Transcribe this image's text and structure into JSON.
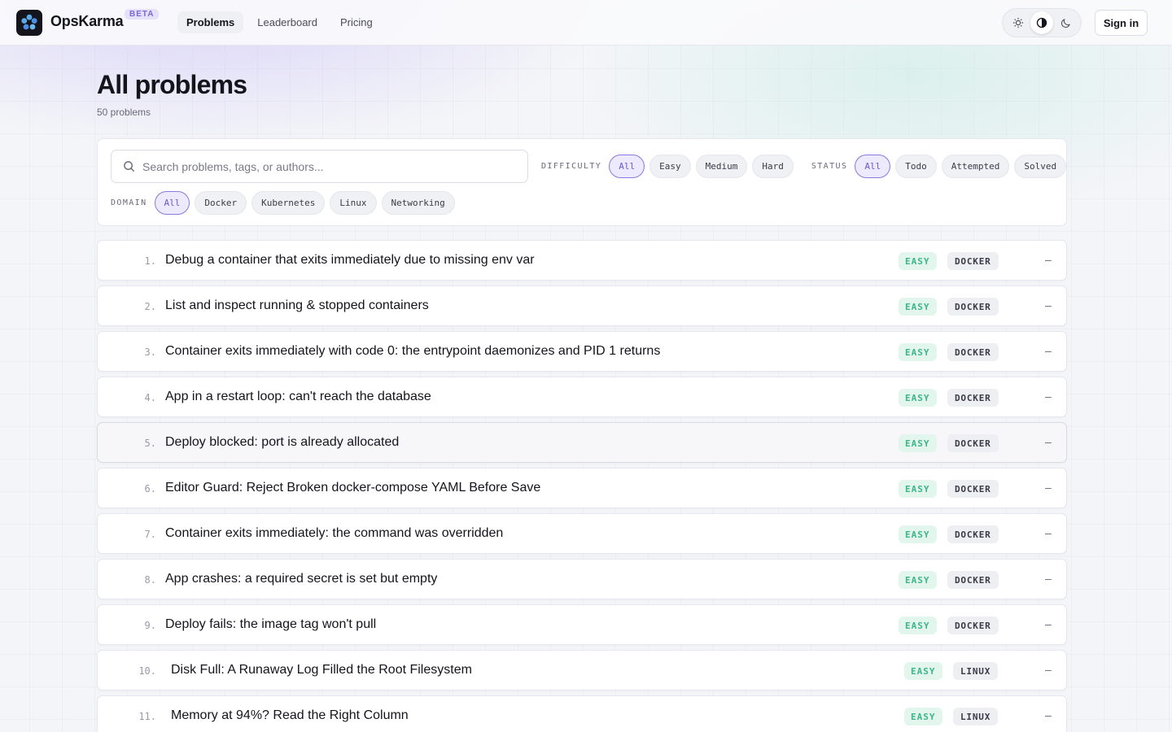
{
  "header": {
    "brand": "OpsKarma",
    "badge": "BETA",
    "nav": [
      "Problems",
      "Leaderboard",
      "Pricing"
    ],
    "active_nav": "Problems",
    "theme_options": [
      "light-icon",
      "system-icon",
      "dark-icon"
    ],
    "active_theme": "system",
    "signin_label": "Sign in"
  },
  "page": {
    "title": "All problems",
    "count": "50 problems"
  },
  "filters": {
    "search_placeholder": "Search problems, tags, or authors...",
    "difficulty_label": "DIFFICULTY",
    "difficulty_options": [
      "All",
      "Easy",
      "Medium",
      "Hard"
    ],
    "difficulty_selected": "All",
    "status_label": "STATUS",
    "status_options": [
      "All",
      "Todo",
      "Attempted",
      "Solved"
    ],
    "status_selected": "All",
    "domain_label": "DOMAIN",
    "domain_options": [
      "All",
      "Docker",
      "Kubernetes",
      "Linux",
      "Networking"
    ],
    "domain_selected": "All"
  },
  "problems": [
    {
      "num": "1.",
      "title": "Debug a container that exits immediately due to missing env var",
      "difficulty": "EASY",
      "domain": "DOCKER",
      "status": "–"
    },
    {
      "num": "2.",
      "title": "List and inspect running & stopped containers",
      "difficulty": "EASY",
      "domain": "DOCKER",
      "status": "–"
    },
    {
      "num": "3.",
      "title": "Container exits immediately with code 0: the entrypoint daemonizes and PID 1 returns",
      "difficulty": "EASY",
      "domain": "DOCKER",
      "status": "–"
    },
    {
      "num": "4.",
      "title": "App in a restart loop: can't reach the database",
      "difficulty": "EASY",
      "domain": "DOCKER",
      "status": "–"
    },
    {
      "num": "5.",
      "title": "Deploy blocked: port is already allocated",
      "difficulty": "EASY",
      "domain": "DOCKER",
      "status": "–"
    },
    {
      "num": "6.",
      "title": "Editor Guard: Reject Broken docker-compose YAML Before Save",
      "difficulty": "EASY",
      "domain": "DOCKER",
      "status": "–"
    },
    {
      "num": "7.",
      "title": "Container exits immediately: the command was overridden",
      "difficulty": "EASY",
      "domain": "DOCKER",
      "status": "–"
    },
    {
      "num": "8.",
      "title": "App crashes: a required secret is set but empty",
      "difficulty": "EASY",
      "domain": "DOCKER",
      "status": "–"
    },
    {
      "num": "9.",
      "title": "Deploy fails: the image tag won't pull",
      "difficulty": "EASY",
      "domain": "DOCKER",
      "status": "–"
    },
    {
      "num": "10.",
      "title": "Disk Full: A Runaway Log Filled the Root Filesystem",
      "difficulty": "EASY",
      "domain": "LINUX",
      "status": "–"
    },
    {
      "num": "11.",
      "title": "Memory at 94%? Read the Right Column",
      "difficulty": "EASY",
      "domain": "LINUX",
      "status": "–"
    }
  ]
}
